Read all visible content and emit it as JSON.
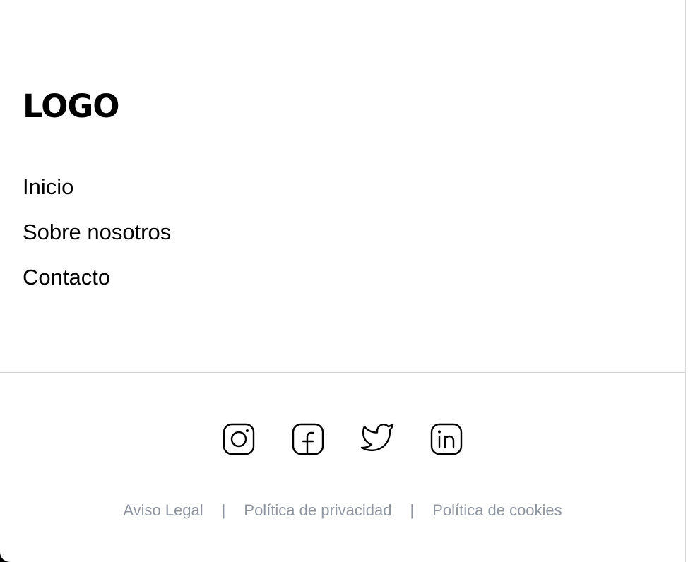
{
  "logo": {
    "text": "LOGO"
  },
  "nav": {
    "items": [
      {
        "label": "Inicio"
      },
      {
        "label": "Sobre nosotros"
      },
      {
        "label": "Contacto"
      }
    ]
  },
  "social": {
    "icons": [
      "instagram-icon",
      "facebook-icon",
      "twitter-icon",
      "linkedin-icon"
    ]
  },
  "legal": {
    "links": [
      {
        "label": "Aviso Legal"
      },
      {
        "label": "Política de privacidad"
      },
      {
        "label": "Política de cookies"
      }
    ],
    "separator": "|"
  },
  "colors": {
    "text": "#000000",
    "muted": "#8e95a2",
    "divider": "#cfcfcf",
    "background": "#ffffff"
  }
}
